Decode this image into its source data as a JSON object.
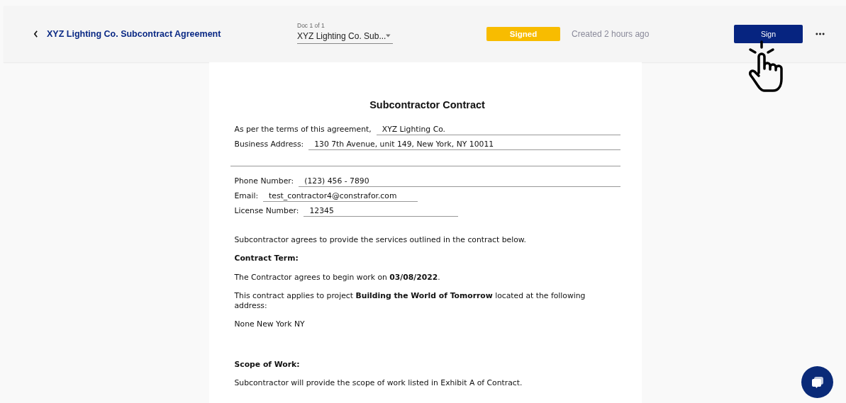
{
  "header": {
    "title": "XYZ Lighting Co. Subcontract Agreement",
    "doc_picker": {
      "caption": "Doc 1 of 1",
      "value": "XYZ Lighting Co. Sub..."
    },
    "status": "Signed",
    "created": "Created 2 hours ago",
    "sign_button": "Sign"
  },
  "document": {
    "title": "Subcontractor Contract",
    "fields": [
      {
        "label": "As per the terms of this agreement,",
        "value": "XYZ Lighting Co.",
        "kind": "wide"
      },
      {
        "label": "Business Address:",
        "value": "130 7th Avenue, unit 149, New York, NY 10011",
        "kind": "wide"
      },
      {
        "kind": "rule"
      },
      {
        "label": "Phone Number:",
        "value": "(123) 456 - 7890",
        "kind": "wide"
      },
      {
        "label": "Email:",
        "value": "test_contractor4@constrafor.com",
        "kind": "short"
      },
      {
        "label": "License Number:",
        "value": "12345",
        "kind": "short"
      }
    ],
    "paragraphs": [
      {
        "kind": "text",
        "text": "Subcontractor agrees to provide the services outlined in the contract below."
      },
      {
        "kind": "heading",
        "text": "Contract Term:"
      },
      {
        "kind": "text",
        "text": "The Contractor agrees to begin work on **03/08/2022**."
      },
      {
        "kind": "text",
        "text": "This contract applies to project **Building the World of Tomorrow** located at the following address:"
      },
      {
        "kind": "text",
        "text": "None New York NY"
      },
      {
        "kind": "gap"
      },
      {
        "kind": "heading",
        "text": "Scope of Work:"
      },
      {
        "kind": "text",
        "text": "Subcontractor will provide the scope of work listed in Exhibit A of Contract."
      }
    ]
  }
}
